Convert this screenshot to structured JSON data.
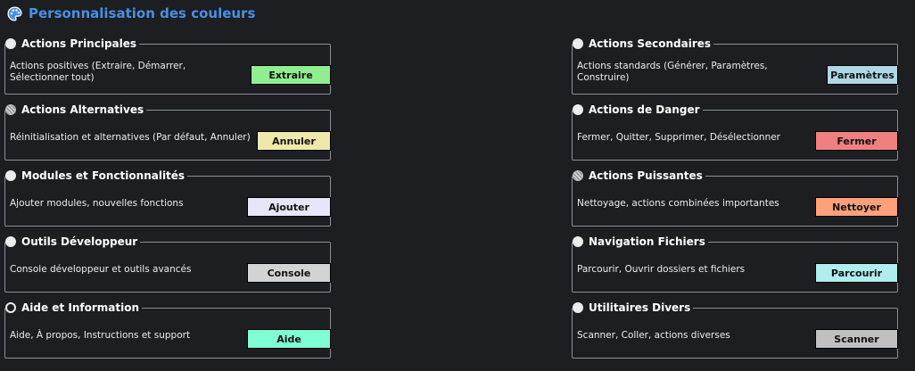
{
  "header": {
    "title": "Personnalisation des couleurs",
    "icon": "palette-icon"
  },
  "groups": [
    {
      "title": "Actions Principales",
      "desc": "Actions positives (Extraire, Démarrer, Sélectionner tout)",
      "button": "Extraire",
      "color": "#90ee90",
      "indicator": "filled-circle"
    },
    {
      "title": "Actions Secondaires",
      "desc": "Actions standards (Générer, Paramètres, Construire)",
      "button": "Paramètres",
      "color": "#add8e6",
      "indicator": "filled-circle"
    },
    {
      "title": "Actions Alternatives",
      "desc": "Réinitialisation et alternatives (Par défaut, Annuler)",
      "button": "Annuler",
      "color": "#eee8aa",
      "indicator": "hatched-circle"
    },
    {
      "title": "Actions de Danger",
      "desc": "Fermer, Quitter, Supprimer, Désélectionner",
      "button": "Fermer",
      "color": "#f08080",
      "indicator": "filled-circle"
    },
    {
      "title": "Modules et Fonctionnalités",
      "desc": "Ajouter modules, nouvelles fonctions",
      "button": "Ajouter",
      "color": "#e6e6fa",
      "indicator": "filled-circle"
    },
    {
      "title": "Actions Puissantes",
      "desc": "Nettoyage, actions combinées importantes",
      "button": "Nettoyer",
      "color": "#ffa07a",
      "indicator": "hatched-circle"
    },
    {
      "title": "Outils Développeur",
      "desc": "Console développeur et outils avancés",
      "button": "Console",
      "color": "#d3d3d3",
      "indicator": "filled-circle"
    },
    {
      "title": "Navigation Fichiers",
      "desc": "Parcourir, Ouvrir dossiers et fichiers",
      "button": "Parcourir",
      "color": "#afeeee",
      "indicator": "filled-circle"
    },
    {
      "title": "Aide et Information",
      "desc": "Aide, À propos, Instructions et support",
      "button": "Aide",
      "color": "#7fffd4",
      "indicator": "ring-circle"
    },
    {
      "title": "Utilitaires Divers",
      "desc": "Scanner, Coller, actions diverses",
      "button": "Scanner",
      "color": "#c0c0c0",
      "indicator": "filled-circle"
    }
  ]
}
